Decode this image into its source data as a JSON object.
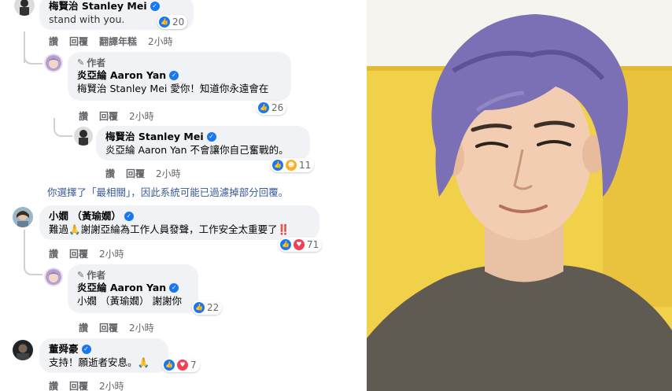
{
  "comments": {
    "c1": {
      "author": "梅賢治 Stanley Mei",
      "text": "stand with you.",
      "reactions": "20",
      "actions": {
        "like": "讚",
        "reply": "回覆",
        "translate": "翻譯年糕",
        "time": "2小時"
      }
    },
    "c2": {
      "role": "作者",
      "author": "炎亞綸 Aaron Yan",
      "text": "梅賢治 Stanley Mei 愛你！知道你永遠會在",
      "reactions": "26",
      "actions": {
        "like": "讚",
        "reply": "回覆",
        "time": "2小時"
      }
    },
    "c3": {
      "author": "梅賢治 Stanley Mei",
      "text": "炎亞綸 Aaron Yan 不會讓你自己奮戰的。",
      "reactions": "11",
      "actions": {
        "like": "讚",
        "reply": "回覆",
        "time": "2小時"
      }
    },
    "filter_note": "你選擇了「最相關」，因此系統可能已過濾掉部分回覆。",
    "c4": {
      "author": "小嫺 （黃瑜嫺）",
      "text": "難過🙏謝謝亞綸為工作人員發聲，工作安全太重要了‼️",
      "reactions": "71",
      "actions": {
        "like": "讚",
        "reply": "回覆",
        "time": "2小時"
      }
    },
    "c5": {
      "role": "作者",
      "author": "炎亞綸 Aaron Yan",
      "text": "小嫺 （黃瑜嫺） 謝謝你",
      "reactions": "22",
      "actions": {
        "like": "讚",
        "reply": "回覆",
        "time": "2小時"
      }
    },
    "c6": {
      "author": "董舜豪",
      "text": "支持！願逝者安息。🙏",
      "reactions": "7",
      "actions": {
        "like": "讚",
        "reply": "回覆",
        "time": "2小時"
      }
    }
  },
  "icons": {
    "verified": "verified-badge-icon",
    "pen": "pencil-icon",
    "like": "like-reaction-icon",
    "love": "love-reaction-icon",
    "care": "care-reaction-icon"
  },
  "colors": {
    "bubble": "#f0f2f5",
    "link": "#385898",
    "meta": "#65676b",
    "like_blue": "#1877f2",
    "love_red": "#f33e58",
    "photo_bg": "#f1d04a",
    "hair": "#7b6fb6"
  }
}
